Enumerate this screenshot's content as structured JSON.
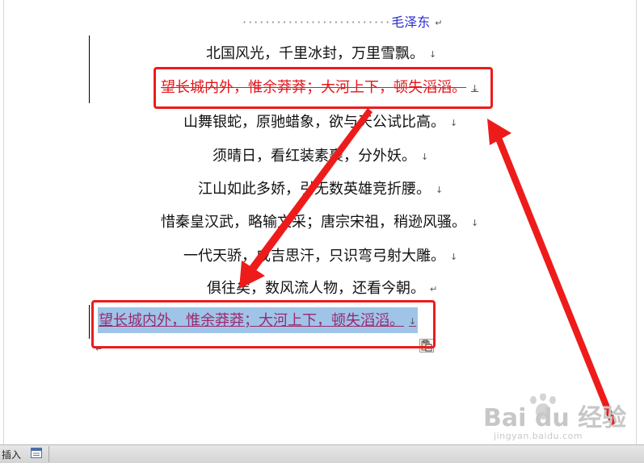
{
  "document": {
    "author_line": {
      "dots": "··························",
      "name": "毛泽东",
      "mark": "↵"
    },
    "lines": [
      {
        "text": "北国风光，千里冰封，万里雪飘。",
        "mark": "↓"
      },
      {
        "text": "望长城内外，惟余莽莽；大河上下，顿失滔滔。",
        "mark": "↓",
        "status": "deleted"
      },
      {
        "text": "山舞银蛇，原驰蜡象，欲与天公试比高。",
        "mark": "↓"
      },
      {
        "text": "须晴日，看红装素裹，分外妖。",
        "mark": "↓"
      },
      {
        "text": "江山如此多娇，引无数英雄竞折腰。",
        "mark": "↓"
      },
      {
        "text": "惜秦皇汉武，略输文采；唐宗宋祖，稍逊风骚。",
        "mark": "↓"
      },
      {
        "text": "一代天骄，成吉思汗，只识弯弓射大雕。",
        "mark": "↓"
      },
      {
        "text": "俱往矣，数风流人物，还看今朝。",
        "mark": "↵"
      },
      {
        "text": "望长城内外，惟余莽莽；大河上下，顿失滔滔。",
        "mark": "↓",
        "status": "inserted"
      }
    ],
    "trailing_mark": "↵"
  },
  "status_bar": {
    "mode_label": "插入",
    "icon": "document-view-icon"
  },
  "annotations": {
    "highlight_color": "#ee1b1b",
    "arrow_color": "#ee1b1b"
  },
  "watermark": {
    "brand": "Bai du 经验",
    "url": "jingyan.baidu.com"
  },
  "colors": {
    "deleted_text": "#e4161b",
    "inserted_text": "#9b2a6e",
    "selection": "#9fc4e8",
    "author_text": "#2c2ccc"
  }
}
